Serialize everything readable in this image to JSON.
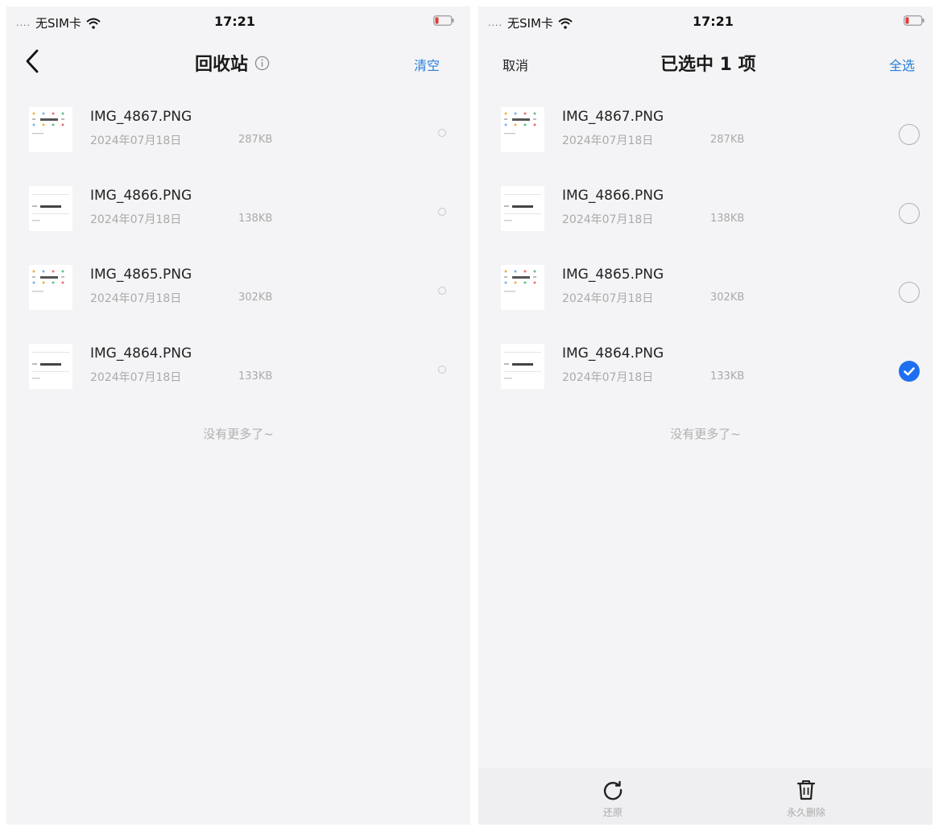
{
  "status_bar": {
    "carrier": "无SIM卡",
    "signal": "....",
    "time": "17:21"
  },
  "left_screen": {
    "title": "回收站",
    "action_label": "清空",
    "files": [
      {
        "name": "IMG_4867.PNG",
        "date": "2024年07月18日",
        "size": "287KB",
        "thumb": "grid"
      },
      {
        "name": "IMG_4866.PNG",
        "date": "2024年07月18日",
        "size": "138KB",
        "thumb": "list"
      },
      {
        "name": "IMG_4865.PNG",
        "date": "2024年07月18日",
        "size": "302KB",
        "thumb": "grid"
      },
      {
        "name": "IMG_4864.PNG",
        "date": "2024年07月18日",
        "size": "133KB",
        "thumb": "list"
      }
    ],
    "footer_text": "没有更多了~"
  },
  "right_screen": {
    "title": "已选中 1 项",
    "cancel_label": "取消",
    "select_all_label": "全选",
    "files": [
      {
        "name": "IMG_4867.PNG",
        "date": "2024年07月18日",
        "size": "287KB",
        "thumb": "grid",
        "selected": false
      },
      {
        "name": "IMG_4866.PNG",
        "date": "2024年07月18日",
        "size": "138KB",
        "thumb": "list",
        "selected": false
      },
      {
        "name": "IMG_4865.PNG",
        "date": "2024年07月18日",
        "size": "302KB",
        "thumb": "grid",
        "selected": false
      },
      {
        "name": "IMG_4864.PNG",
        "date": "2024年07月18日",
        "size": "133KB",
        "thumb": "list",
        "selected": true
      }
    ],
    "footer_text": "没有更多了~",
    "toolbar": {
      "restore_label": "还原",
      "delete_label": "永久删除"
    }
  },
  "colors": {
    "accent": "#2a7fd8",
    "checked": "#1e6ff0",
    "background": "#f4f4f6",
    "muted_text": "#aaaaaa"
  },
  "icons": {
    "back": "chevron-left-icon",
    "info": "info-circle-icon",
    "wifi": "wifi-icon",
    "battery": "battery-low-icon",
    "restore": "rotate-icon",
    "delete": "trash-icon"
  }
}
